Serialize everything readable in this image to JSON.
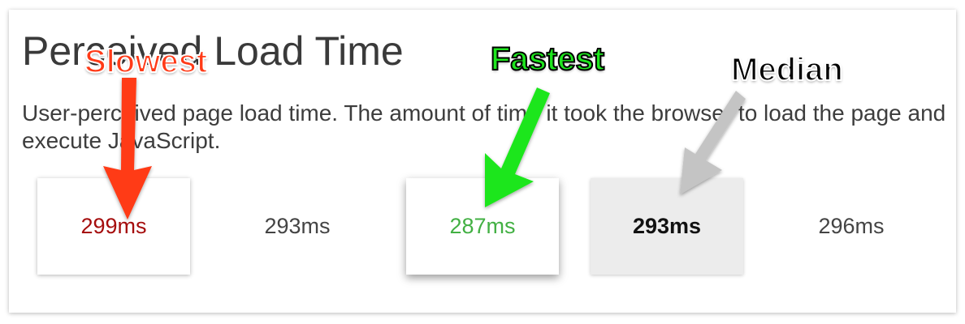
{
  "panel": {
    "title": "Perceived Load Time",
    "description": "User-perceived page load time. The amount of time it took the browser to load the page and execute JavaScript."
  },
  "runs": [
    {
      "label": "299ms",
      "value_ms": 299,
      "tag": "slowest"
    },
    {
      "label": "293ms",
      "value_ms": 293,
      "tag": ""
    },
    {
      "label": "287ms",
      "value_ms": 287,
      "tag": "fastest"
    },
    {
      "label": "293ms",
      "value_ms": 293,
      "tag": "median"
    },
    {
      "label": "296ms",
      "value_ms": 296,
      "tag": ""
    }
  ],
  "annotations": {
    "slowest": {
      "text": "Slowest",
      "color": "#ff3a17"
    },
    "fastest": {
      "text": "Fastest",
      "color": "#1ee61e"
    },
    "median": {
      "text": "Median",
      "color": "#c4c4c4"
    }
  },
  "colors": {
    "slow_value": "#a50d0d",
    "fast_value": "#42b043",
    "median_box": "#ececec"
  }
}
